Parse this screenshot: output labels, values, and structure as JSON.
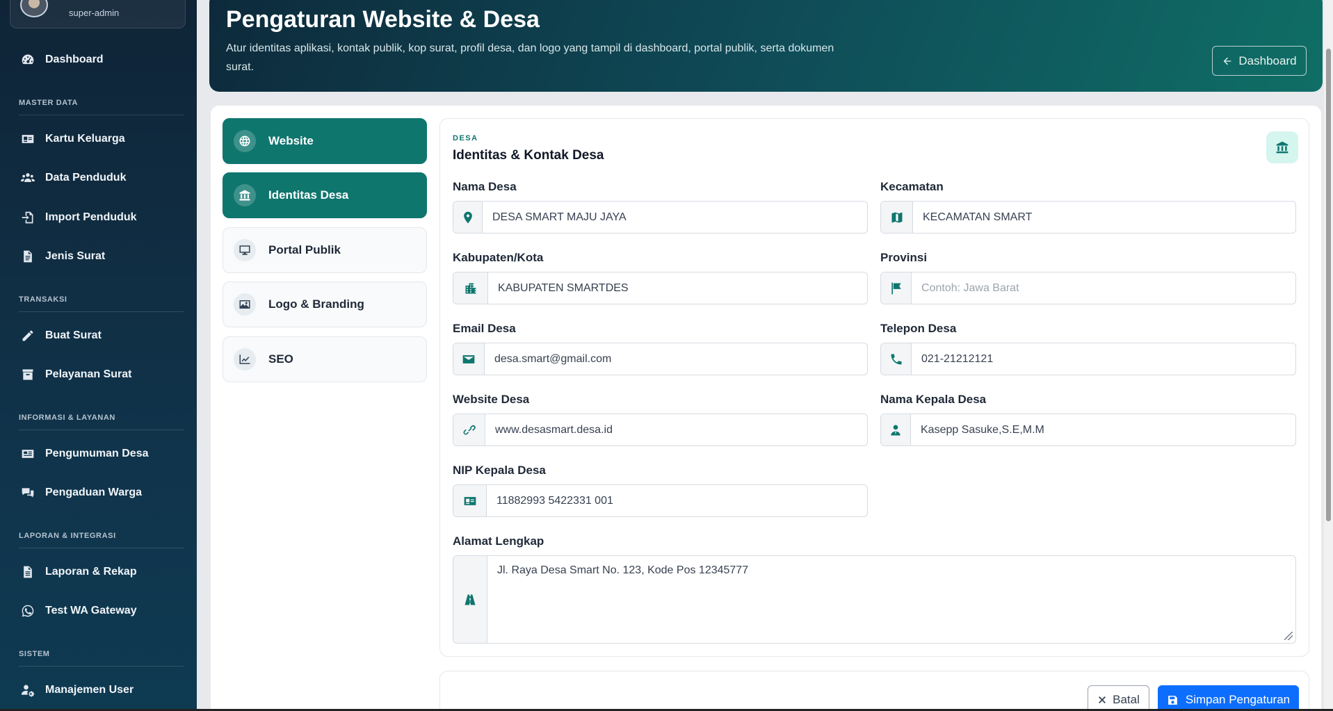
{
  "sidebar": {
    "user_role": "super-admin",
    "dashboard": "Dashboard",
    "sections": {
      "master": "MASTER DATA",
      "transaksi": "TRANSAKSI",
      "informasi": "INFORMASI & LAYANAN",
      "laporan": "LAPORAN & INTEGRASI",
      "sistem": "SISTEM"
    },
    "items": {
      "kartu_keluarga": "Kartu Keluarga",
      "data_penduduk": "Data Penduduk",
      "import_penduduk": "Import Penduduk",
      "jenis_surat": "Jenis Surat",
      "buat_surat": "Buat Surat",
      "pelayanan_surat": "Pelayanan Surat",
      "pengumuman_desa": "Pengumuman Desa",
      "pengaduan_warga": "Pengaduan Warga",
      "laporan_rekap": "Laporan & Rekap",
      "test_wa": "Test WA Gateway",
      "manajemen_user": "Manajemen User"
    }
  },
  "header": {
    "title": "Pengaturan Website & Desa",
    "description": "Atur identitas aplikasi, kontak publik, kop surat, profil desa, dan logo yang tampil di dashboard, portal publik, serta dokumen surat.",
    "dashboard_button": "Dashboard"
  },
  "tabs": {
    "website": "Website",
    "identitas": "Identitas Desa",
    "portal": "Portal Publik",
    "logo": "Logo & Branding",
    "seo": "SEO"
  },
  "panel": {
    "eyebrow": "DESA",
    "title": "Identitas & Kontak Desa"
  },
  "form": {
    "nama_desa": {
      "label": "Nama Desa",
      "value": "DESA SMART MAJU JAYA"
    },
    "kecamatan": {
      "label": "Kecamatan",
      "value": "KECAMATAN SMART"
    },
    "kabupaten": {
      "label": "Kabupaten/Kota",
      "value": "KABUPATEN SMARTDES"
    },
    "provinsi": {
      "label": "Provinsi",
      "value": "",
      "placeholder": "Contoh: Jawa Barat"
    },
    "email": {
      "label": "Email Desa",
      "value": "desa.smart@gmail.com"
    },
    "telepon": {
      "label": "Telepon Desa",
      "value": "021-21212121"
    },
    "website": {
      "label": "Website Desa",
      "value": "www.desasmart.desa.id"
    },
    "kepala": {
      "label": "Nama Kepala Desa",
      "value": "Kasepp Sasuke,S.E,M.M"
    },
    "nip": {
      "label": "NIP Kepala Desa",
      "value": "11882993 5422331 001"
    },
    "alamat": {
      "label": "Alamat Lengkap",
      "value": "Jl. Raya Desa Smart No. 123, Kode Pos 12345777"
    }
  },
  "actions": {
    "cancel": "Batal",
    "save": "Simpan Pengaturan"
  },
  "colors": {
    "primary": "#0f766e",
    "save_button": "#0d6efd",
    "sidebar_bg": "#0f2437"
  }
}
